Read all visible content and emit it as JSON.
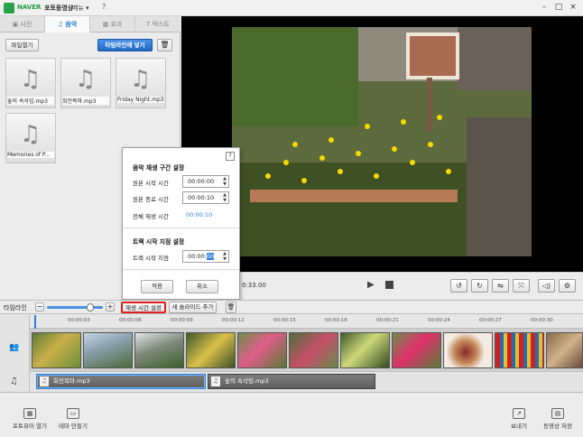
{
  "titlebar": {
    "brand": "NAVER",
    "app_title": "포토동영상",
    "menu_label": "메뉴 ▾",
    "help": "?",
    "minimize": "–",
    "restore": "□",
    "close": "×"
  },
  "tabs": [
    {
      "label": "사진",
      "icon": "photo-icon"
    },
    {
      "label": "음악",
      "icon": "music-note-icon"
    },
    {
      "label": "효과",
      "icon": "effect-icon"
    },
    {
      "label": "텍스트",
      "icon": "text-icon"
    }
  ],
  "music_panel": {
    "open_file_label": "파일열기",
    "add_to_timeline_label": "타임라인에 넣기",
    "files": [
      "숲의 속삭임.mp3",
      "회전목마.mp3",
      "Friday Night.mp3",
      "Memories of P..."
    ]
  },
  "popup": {
    "help": "?",
    "section1_title": "음악 재생 구간 설정",
    "source_start_label": "원본 시작 시간",
    "source_start_value": "00:00:00",
    "source_end_label": "원본 종료 시간",
    "source_end_value": "00:00:10",
    "total_label": "전체 재생 시간",
    "total_value": "00:00:10",
    "section2_title": "트랙 시작 지점 설정",
    "track_start_label": "트랙 시작 지점",
    "track_start_value": "00:00:",
    "track_start_selected": "00",
    "apply_label": "적용",
    "cancel_label": "취소"
  },
  "preview": {
    "time_readout": "0:33.00"
  },
  "timeline": {
    "label": "타임라인",
    "zoom_minus": "−",
    "zoom_plus": "+",
    "zoom_level": 0.78,
    "set_play_time_label": "재생 시간 설정",
    "add_slide_label": "새 슬라이드 추가",
    "ticks": [
      "00:00:03",
      "00:00:06",
      "00:00:09",
      "00:00:12",
      "00:00:15",
      "00:00:18",
      "00:00:21",
      "00:00:24",
      "00:00:27",
      "00:00:30"
    ],
    "audio_clips": [
      "회전목마.mp3",
      "숲의 속삭임.mp3"
    ]
  },
  "bottom": {
    "photo_viewer_label": "포토뷰어 열기",
    "theme_label": "테마 만들기",
    "export_label": "보내기",
    "save_video_label": "동영상 저장"
  },
  "colors": {
    "accent": "#2a7fd8",
    "brand": "#1e9e3d",
    "highlight_red": "#e0201b"
  }
}
